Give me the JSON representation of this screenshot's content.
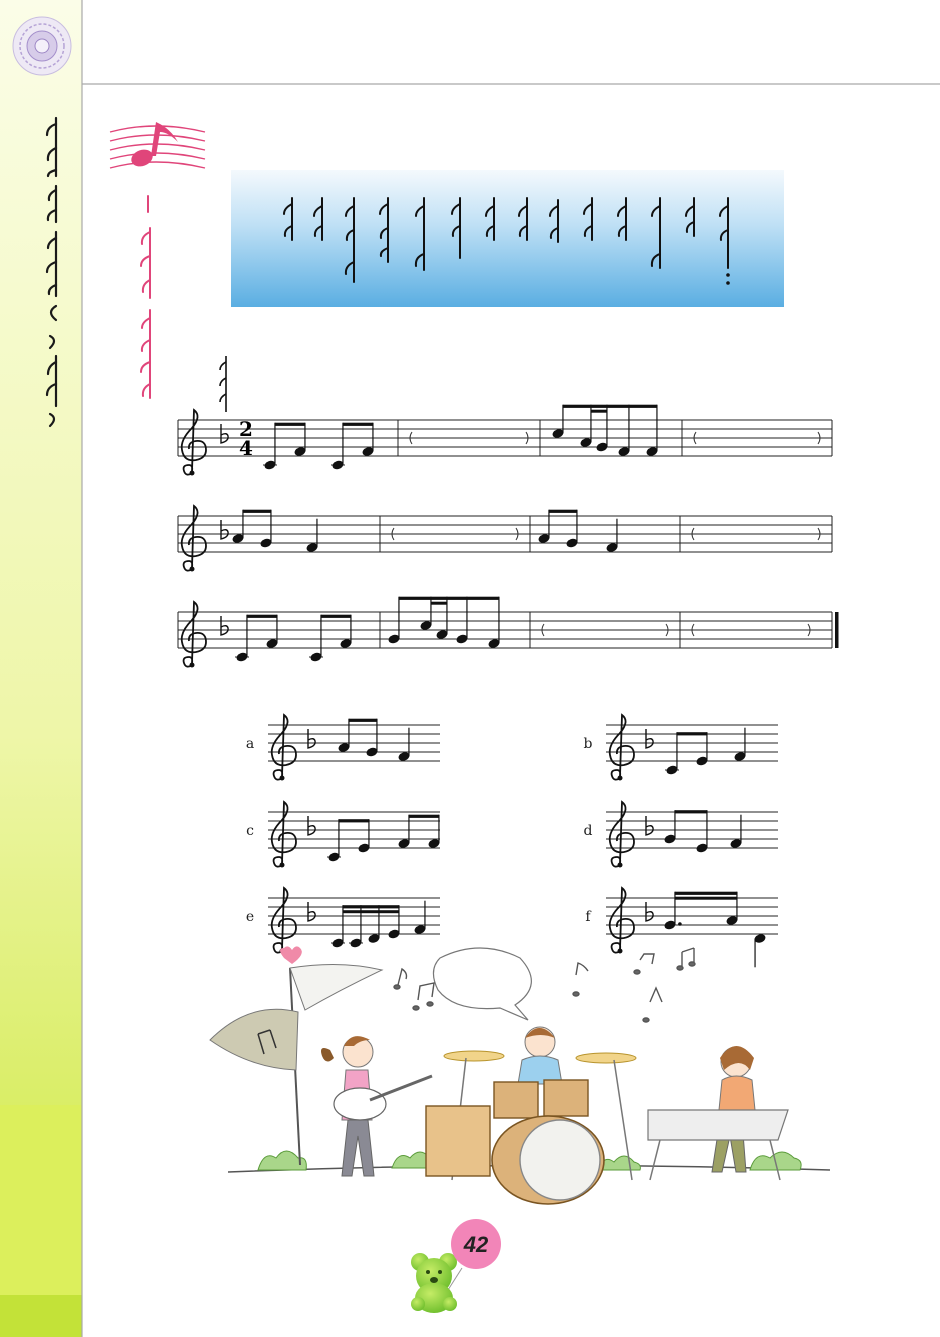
{
  "page": {
    "number": "42"
  },
  "colors": {
    "sidebar_top": "#f7fad2",
    "sidebar_bottom": "#c9e53d",
    "banner_top": "#f2f8fd",
    "banner_bottom": "#5caee2",
    "accent_pink": "#e0457a",
    "page_circle": "#f285b8"
  },
  "score": {
    "key_signature": "F major (one flat)",
    "time_signature": {
      "top": "2",
      "bottom": "4"
    },
    "staves": [
      {
        "measures": [
          "C F C F",
          "( )",
          "C A G F F",
          "( )"
        ]
      },
      {
        "measures": [
          "A G F",
          "( )",
          "A G F",
          "( )"
        ]
      },
      {
        "measures": [
          "C F C F",
          "G C A G F",
          "( )",
          "( )"
        ]
      }
    ]
  },
  "options": [
    {
      "label": "a",
      "notes": "A G F"
    },
    {
      "label": "b",
      "notes": "C E F"
    },
    {
      "label": "c",
      "notes": "C E F F"
    },
    {
      "label": "d",
      "notes": "G E F"
    },
    {
      "label": "e",
      "notes": "C C D E F"
    },
    {
      "label": "f",
      "notes": "G. A D"
    }
  ],
  "icons": [
    "rosette-emblem-icon",
    "music-note-icon",
    "teddy-bear-icon",
    "band-illustration",
    "speech-bubble-icon"
  ]
}
